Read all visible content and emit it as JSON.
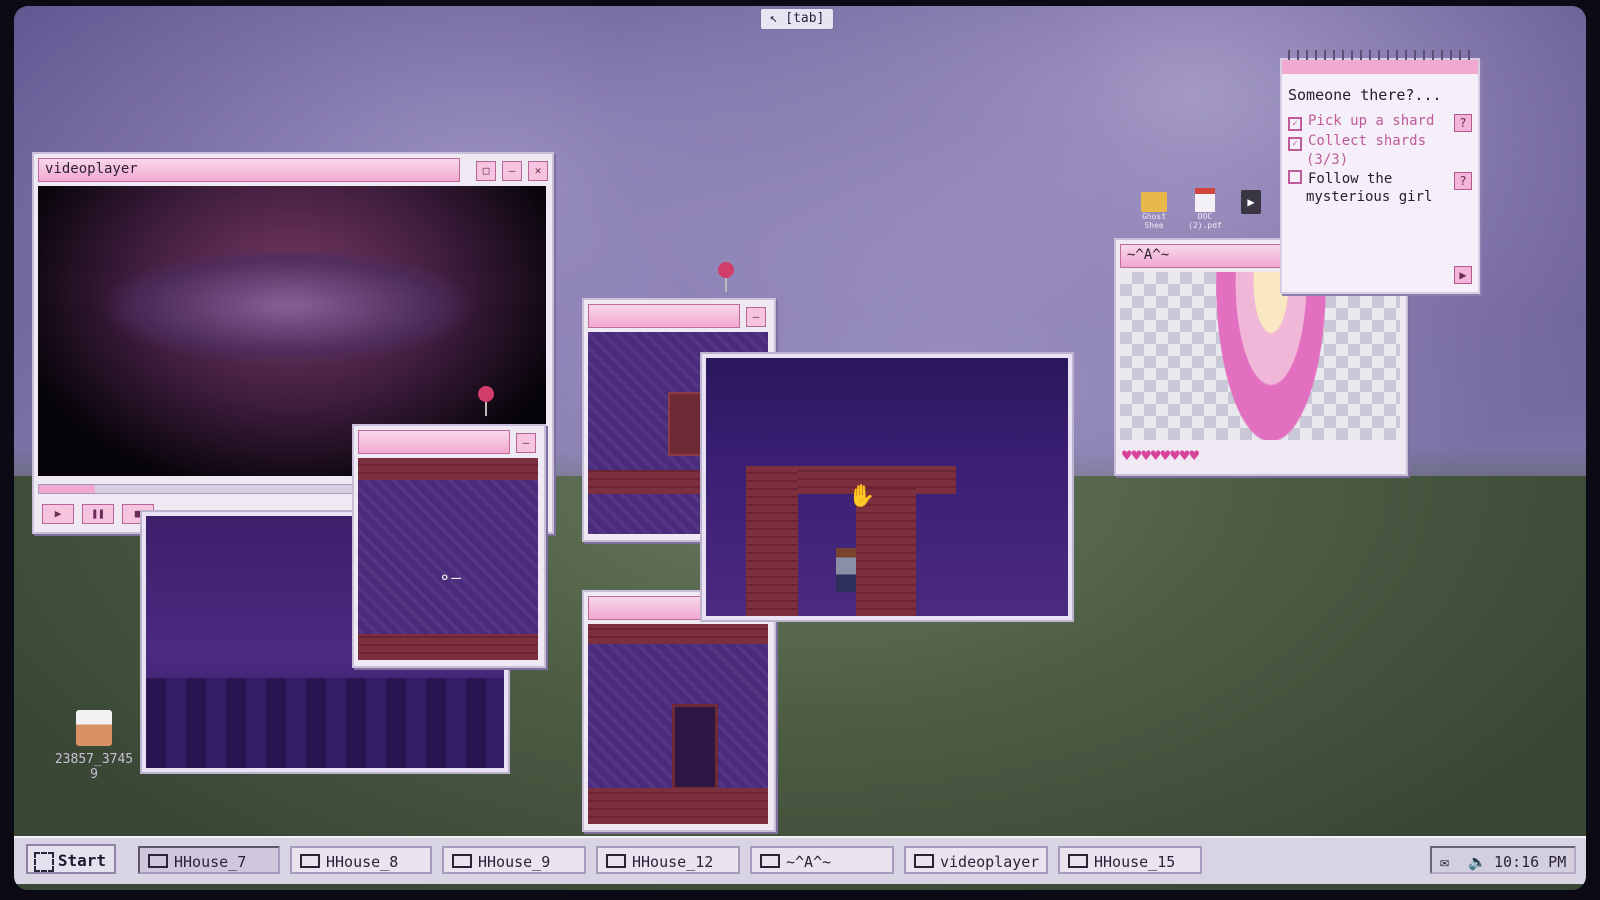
{
  "tab_hint": "[tab]",
  "notepad": {
    "title": "Someone there?...",
    "tasks": [
      {
        "label": "Pick up a shard",
        "checked": true,
        "help": "?"
      },
      {
        "label": "Collect shards",
        "progress": "(3/3)",
        "checked": true
      },
      {
        "label": "Follow the",
        "label2": "mysterious girl",
        "checked": false,
        "help": "?"
      }
    ]
  },
  "windows": {
    "videoplayer": {
      "title": "videoplayer"
    },
    "girl_window": {
      "title": "~^A^~",
      "hearts_full": 8
    }
  },
  "desktop_icons": [
    {
      "label": "Ghost Shee",
      "icon": "folder-icon"
    },
    {
      "label": "DOC (2).pdf",
      "icon": "pdf-icon"
    },
    {
      "label": "",
      "icon": "video-file-icon"
    }
  ],
  "desktop_box_label": {
    "line1": "23857_3745",
    "line2": "9"
  },
  "taskbar": {
    "start": "Start",
    "buttons": [
      "HHouse_7",
      "HHouse_8",
      "HHouse_9",
      "HHouse_12",
      "~^A^~",
      "videoplayer",
      "HHouse_15"
    ],
    "time": "10:16 PM"
  },
  "colors": {
    "accent_pink": "#f2a9d0",
    "window_bg": "#efe9f4",
    "room_purple": "#4a2a7a",
    "brick": "#7c2f3c"
  }
}
